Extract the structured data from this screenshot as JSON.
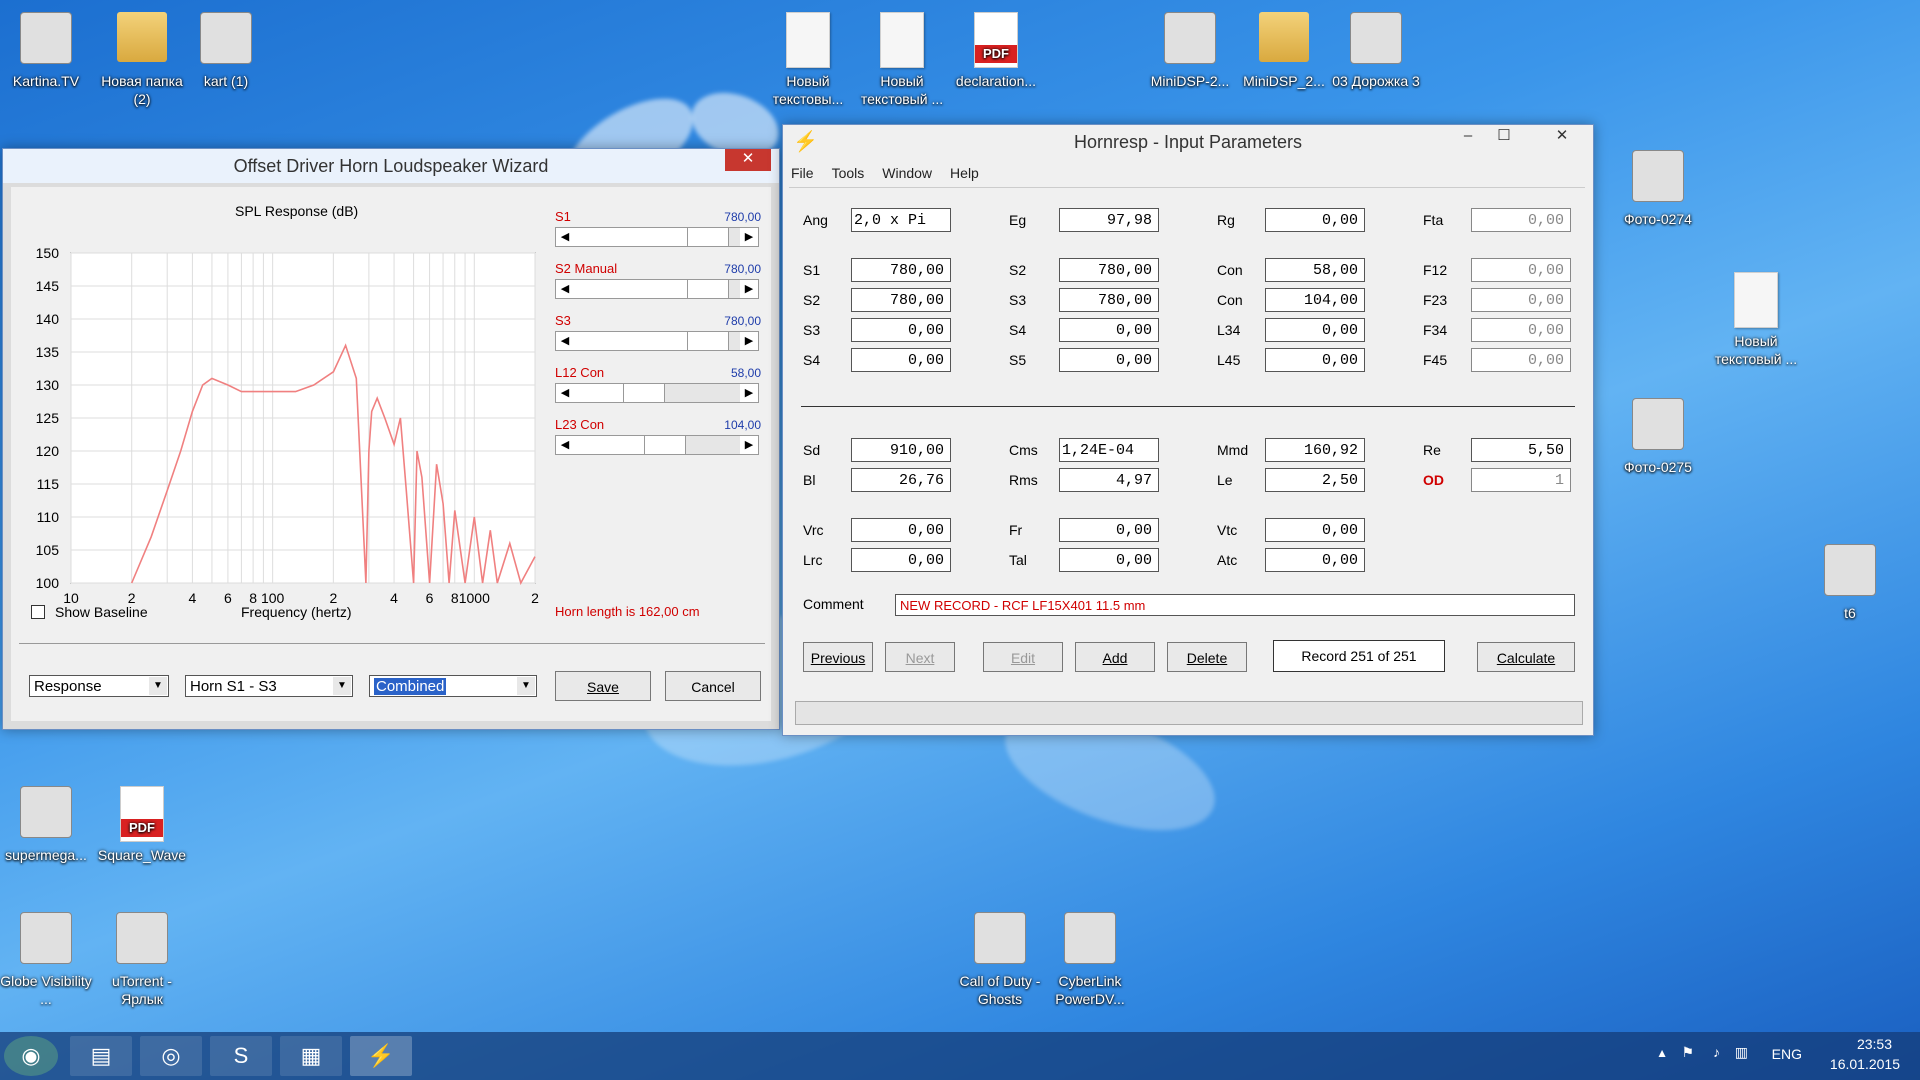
{
  "desktop_icons": [
    {
      "label": "Kartina.TV",
      "icon": "kartina-tv-icon"
    },
    {
      "label": "Новая папка (2)",
      "icon": "folder-icon"
    },
    {
      "label": "kart (1)",
      "icon": "archive-icon"
    },
    {
      "label": "Новый текстовы...",
      "icon": "text-document-icon"
    },
    {
      "label": "Новый текстовый ...",
      "icon": "text-document-icon"
    },
    {
      "label": "declaration...",
      "icon": "pdf-icon"
    },
    {
      "label": "MiniDSP-2...",
      "icon": "minidsp-icon"
    },
    {
      "label": "MiniDSP_2...",
      "icon": "folder-icon"
    },
    {
      "label": "03 Дорожка 3",
      "icon": "mp3-icon"
    },
    {
      "label": "Фото-0274",
      "icon": "photo-icon"
    },
    {
      "label": "Новый текстовый ...",
      "icon": "text-document-icon"
    },
    {
      "label": "Фото-0275",
      "icon": "photo-icon"
    },
    {
      "label": "t6",
      "icon": "image-icon"
    },
    {
      "label": "supermega...",
      "icon": "installer-icon"
    },
    {
      "label": "Square_Wave",
      "icon": "pdf-icon"
    },
    {
      "label": "Globe Visibility ...",
      "icon": "globe-visibility-icon"
    },
    {
      "label": "uTorrent - Ярлык",
      "icon": "utorrent-icon"
    },
    {
      "label": "Call of Duty - Ghosts",
      "icon": "call-of-duty-icon"
    },
    {
      "label": "CyberLink PowerDV...",
      "icon": "cyberlink-icon"
    }
  ],
  "pdf_badge": "PDF",
  "wizard": {
    "title": "Offset Driver Horn Loudspeaker Wizard",
    "close": "✕",
    "chart_title": "SPL Response (dB)",
    "y_ticks": [
      "150",
      "145",
      "140",
      "135",
      "130",
      "125",
      "120",
      "115",
      "110",
      "105",
      "100"
    ],
    "x_ticks": [
      "10",
      "2",
      "4",
      "6",
      "8",
      "100",
      "2",
      "4",
      "6",
      "8",
      "1000",
      "2"
    ],
    "xlabel": "Frequency (hertz)",
    "show_baseline": "Show Baseline",
    "horn_length": "Horn length is 162,00 cm",
    "sliders": [
      {
        "label": "S1",
        "value": "780,00",
        "pos": 0.88
      },
      {
        "label": "S2 Manual",
        "value": "780,00",
        "pos": 0.88
      },
      {
        "label": "S3",
        "value": "780,00",
        "pos": 0.88
      },
      {
        "label": "L12 Con",
        "value": "58,00",
        "pos": 0.38
      },
      {
        "label": "L23 Con",
        "value": "104,00",
        "pos": 0.55
      }
    ],
    "combo_response": "Response",
    "combo_horn": "Horn S1 - S3",
    "combo_combined": "Combined",
    "save": "Save",
    "cancel": "Cancel"
  },
  "chart_data": {
    "type": "line",
    "title": "SPL Response (dB)",
    "xlabel": "Frequency (hertz)",
    "ylabel": "",
    "x_scale": "log",
    "xlim": [
      10,
      2000
    ],
    "ylim": [
      100,
      150
    ],
    "grid": true,
    "series": [
      {
        "color": "#f08080",
        "x": [
          20,
          25,
          30,
          35,
          40,
          45,
          50,
          60,
          70,
          80,
          100,
          130,
          160,
          200,
          230,
          260,
          280,
          290,
          300,
          310,
          330,
          360,
          400,
          430,
          460,
          500,
          520,
          550,
          600,
          650,
          700,
          750,
          800,
          900,
          1000,
          1100,
          1200,
          1300,
          1500,
          1700,
          2000
        ],
        "y": [
          100,
          107,
          114,
          120,
          126,
          130,
          131,
          130,
          129,
          129,
          129,
          129,
          130,
          132,
          136,
          131,
          110,
          100,
          120,
          126,
          128,
          125,
          121,
          125,
          114,
          100,
          120,
          116,
          100,
          118,
          112,
          100,
          111,
          100,
          110,
          100,
          108,
          100,
          106,
          100,
          104
        ]
      }
    ]
  },
  "hornresp": {
    "title": "Hornresp - Input Parameters",
    "menu": [
      "File",
      "Tools",
      "Window",
      "Help"
    ],
    "rows1": [
      [
        {
          "l": "Ang",
          "v": "2,0 x Pi",
          "left": true
        },
        {
          "l": "Eg",
          "v": "97,98"
        },
        {
          "l": "Rg",
          "v": "0,00"
        },
        {
          "l": "Fta",
          "v": "0,00",
          "dis": true
        }
      ],
      [
        {
          "l": "S1",
          "v": "780,00"
        },
        {
          "l": "S2",
          "v": "780,00"
        },
        {
          "l": "Con",
          "v": "58,00"
        },
        {
          "l": "F12",
          "v": "0,00",
          "dis": true
        }
      ],
      [
        {
          "l": "S2",
          "v": "780,00"
        },
        {
          "l": "S3",
          "v": "780,00"
        },
        {
          "l": "Con",
          "v": "104,00"
        },
        {
          "l": "F23",
          "v": "0,00",
          "dis": true
        }
      ],
      [
        {
          "l": "S3",
          "v": "0,00"
        },
        {
          "l": "S4",
          "v": "0,00"
        },
        {
          "l": "L34",
          "v": "0,00"
        },
        {
          "l": "F34",
          "v": "0,00",
          "dis": true
        }
      ],
      [
        {
          "l": "S4",
          "v": "0,00"
        },
        {
          "l": "S5",
          "v": "0,00"
        },
        {
          "l": "L45",
          "v": "0,00"
        },
        {
          "l": "F45",
          "v": "0,00",
          "dis": true
        }
      ]
    ],
    "rows2": [
      [
        {
          "l": "Sd",
          "v": "910,00"
        },
        {
          "l": "Cms",
          "v": "1,24E-04",
          "left": true
        },
        {
          "l": "Mmd",
          "v": "160,92"
        },
        {
          "l": "Re",
          "v": "5,50"
        }
      ],
      [
        {
          "l": "Bl",
          "v": "26,76"
        },
        {
          "l": "Rms",
          "v": "4,97"
        },
        {
          "l": "Le",
          "v": "2,50"
        },
        {
          "l": "OD",
          "v": "1",
          "red": true,
          "dis": true
        }
      ],
      [
        {
          "l": "Vrc",
          "v": "0,00"
        },
        {
          "l": "Fr",
          "v": "0,00"
        },
        {
          "l": "Vtc",
          "v": "0,00"
        }
      ],
      [
        {
          "l": "Lrc",
          "v": "0,00"
        },
        {
          "l": "Tal",
          "v": "0,00"
        },
        {
          "l": "Atc",
          "v": "0,00"
        }
      ]
    ],
    "comment_label": "Comment",
    "comment": "NEW RECORD - RCF LF15X401 11.5 mm",
    "buttons": {
      "previous": "Previous",
      "next": "Next",
      "edit": "Edit",
      "add": "Add",
      "delete": "Delete",
      "calculate": "Calculate"
    },
    "record": "Record 251 of 251"
  },
  "taskbar": {
    "lang": "ENG",
    "time": "23:53",
    "date": "16.01.2015"
  },
  "colors": {
    "accent": "#d00000",
    "value_blue": "#1e3caa",
    "curve": "#f08080"
  }
}
